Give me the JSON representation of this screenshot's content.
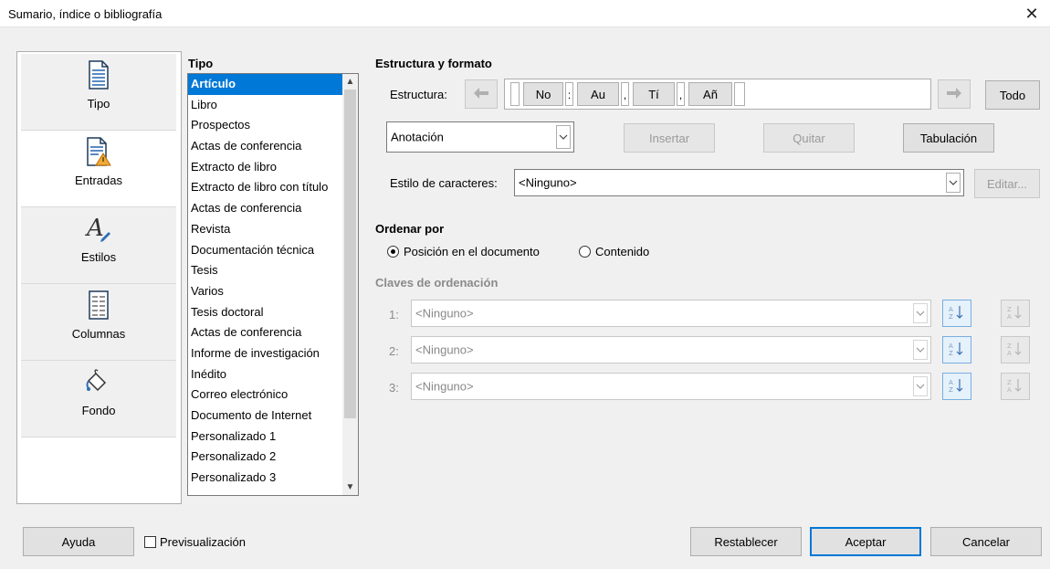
{
  "window": {
    "title": "Sumario, índice o bibliografía",
    "close_symbol": "✕"
  },
  "sidebar": {
    "items": [
      {
        "label": "Tipo",
        "icon": "document-lines-icon",
        "active": false
      },
      {
        "label": "Entradas",
        "icon": "document-warning-icon",
        "active": true
      },
      {
        "label": "Estilos",
        "icon": "styles-pen-icon",
        "active": false
      },
      {
        "label": "Columnas",
        "icon": "columns-icon",
        "active": false
      },
      {
        "label": "Fondo",
        "icon": "paint-bucket-icon",
        "active": false
      }
    ]
  },
  "tipo": {
    "title": "Tipo",
    "items": [
      "Artículo",
      "Libro",
      "Prospectos",
      "Actas de conferencia",
      "Extracto de libro",
      "Extracto de libro con título",
      "Actas de conferencia",
      "Revista",
      "Documentación técnica",
      "Tesis",
      "Varios",
      "Tesis doctoral",
      "Actas de conferencia",
      "Informe de investigación",
      "Inédito",
      "Correo electrónico",
      "Documento de Internet",
      "Personalizado 1",
      "Personalizado 2",
      "Personalizado 3"
    ],
    "selected_index": 0
  },
  "structure": {
    "section_title": "Estructura y formato",
    "label": "Estructura:",
    "tokens": [
      "No",
      "Au",
      "Tí",
      "Añ"
    ],
    "separators": [
      ":",
      ",",
      ","
    ],
    "all_button": "Todo",
    "field_select": "Anotación",
    "insert_button": "Insertar",
    "remove_button": "Quitar",
    "tab_button": "Tabulación",
    "char_style_label": "Estilo de caracteres:",
    "char_style_value": "<Ninguno>",
    "edit_button": "Editar..."
  },
  "sort": {
    "section_title": "Ordenar por",
    "option_position": "Posición en el documento",
    "option_content": "Contenido",
    "selected": "position",
    "keys_title": "Claves de ordenación",
    "keys": [
      {
        "num": "1:",
        "value": "<Ninguno>"
      },
      {
        "num": "2:",
        "value": "<Ninguno>"
      },
      {
        "num": "3:",
        "value": "<Ninguno>"
      }
    ]
  },
  "footer": {
    "help_button": "Ayuda",
    "preview_label": "Previsualización",
    "preview_checked": false,
    "reset_button": "Restablecer",
    "ok_button": "Aceptar",
    "cancel_button": "Cancelar"
  },
  "colors": {
    "accent": "#0078d7",
    "selection": "#0078d7"
  }
}
